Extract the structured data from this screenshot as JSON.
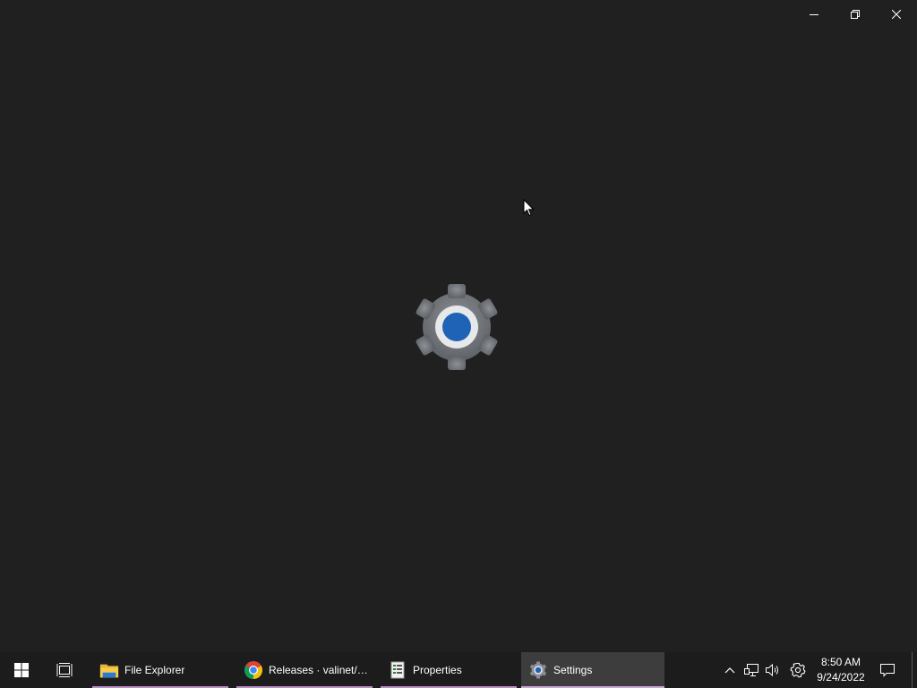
{
  "window": {
    "app": "Settings",
    "caption_buttons": [
      {
        "name": "minimize-button",
        "icon": "minimize-icon"
      },
      {
        "name": "restore-button",
        "icon": "restore-icon"
      },
      {
        "name": "close-button",
        "icon": "close-icon"
      }
    ],
    "splash_icon": "settings-gear-icon"
  },
  "taskbar": {
    "start_icon": "windows-logo-icon",
    "task_view_icon": "task-view-icon",
    "apps": [
      {
        "label": "File Explorer",
        "icon": "folder-icon",
        "active": false
      },
      {
        "label": "Releases · valinet/E...",
        "icon": "chrome-icon",
        "active": false
      },
      {
        "label": "Properties",
        "icon": "properties-icon",
        "active": false
      },
      {
        "label": "Settings",
        "icon": "settings-gear-icon",
        "active": true
      }
    ],
    "tray": {
      "icons": [
        "chevron-up-icon",
        "network-icon",
        "volume-icon",
        "gear-icon"
      ],
      "time": "8:50 AM",
      "date": "9/24/2022",
      "notification_icon": "action-center-icon"
    }
  },
  "colors": {
    "background": "#202020",
    "taskbar": "#1c1c1c",
    "active_app": "#3d3d3d",
    "running_indicator": "#b98fc6",
    "accent_blue": "#1e63b5"
  }
}
